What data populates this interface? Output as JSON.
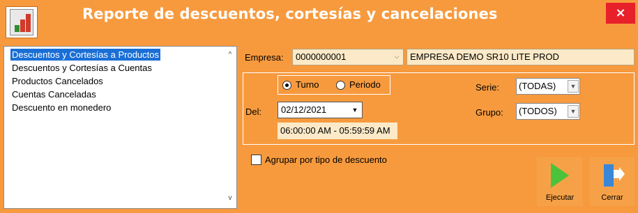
{
  "window": {
    "title": "Reporte de descuentos, cortesías y cancelaciones",
    "close_glyph": "×",
    "app_icon": "report-chart-icon"
  },
  "report_list": {
    "items": [
      {
        "label": "Descuentos y Cortesías a Productos",
        "selected": true
      },
      {
        "label": "Descuentos y Cortesías a Cuentas",
        "selected": false
      },
      {
        "label": "Productos Cancelados",
        "selected": false
      },
      {
        "label": "Cuentas Canceladas",
        "selected": false
      },
      {
        "label": "Descuento en monedero",
        "selected": false
      }
    ],
    "scroll_up_glyph": "^",
    "scroll_down_glyph": "v"
  },
  "empresa": {
    "label": "Empresa:",
    "code": "0000000001",
    "name": "EMPRESA DEMO SR10 LITE PROD"
  },
  "mode": {
    "turno_label": "Turno",
    "periodo_label": "Periodo",
    "selected": "Turno"
  },
  "filters": {
    "del_label": "Del:",
    "date_value": "02/12/2021",
    "time_range": "06:00:00 AM - 05:59:59 AM",
    "serie_label": "Serie:",
    "serie_value": "(TODAS)",
    "grupo_label": "Grupo:",
    "grupo_value": "(TODOS)"
  },
  "options": {
    "group_by_discount_label": "Agrupar por tipo de descuento",
    "group_by_discount_checked": false
  },
  "actions": {
    "run_label": "Ejecutar",
    "close_label": "Cerrar"
  },
  "colors": {
    "background": "#f79a3e",
    "field_fill": "#fbe9c7",
    "selection": "#1a6fd6",
    "close_button": "#e8202a",
    "run_icon": "#4cc23a",
    "exit_icon": "#3a86d8"
  }
}
